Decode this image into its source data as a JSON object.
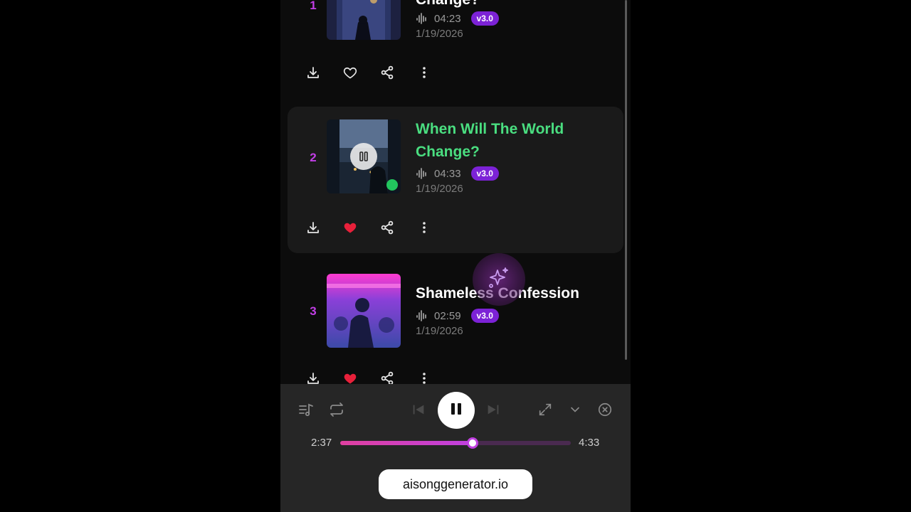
{
  "tracks": [
    {
      "number": "1",
      "title": "Change?",
      "duration": "04:23",
      "version": "v3.0",
      "date": "1/19/2026",
      "liked": false
    },
    {
      "number": "2",
      "title": "When Will The World Change?",
      "duration": "04:33",
      "version": "v3.0",
      "date": "1/19/2026",
      "liked": true,
      "playing": true
    },
    {
      "number": "3",
      "title": "Shameless Confession",
      "duration": "02:59",
      "version": "v3.0",
      "date": "1/19/2026",
      "liked": true
    }
  ],
  "player": {
    "elapsed": "2:37",
    "total": "4:33",
    "progress": 0.575,
    "site_label": "aisonggenerator.io"
  },
  "colors": {
    "accent_purple": "#7c22d6",
    "track_number": "#c23ee6",
    "active_title": "#4ade80",
    "liked_heart": "#e8203a",
    "progress_start": "#e040a0",
    "progress_end": "#c040e0"
  },
  "icons": {
    "download": "download-icon",
    "like": "heart-icon",
    "share": "share-icon",
    "more": "more-vertical-icon",
    "queue": "playlist-icon",
    "repeat": "repeat-icon",
    "prev": "skip-previous-icon",
    "play_pause": "pause-icon",
    "next": "skip-next-icon",
    "expand": "expand-icon",
    "collapse": "chevron-down-icon",
    "close": "close-circle-icon",
    "sparkle": "sparkle-icon"
  }
}
